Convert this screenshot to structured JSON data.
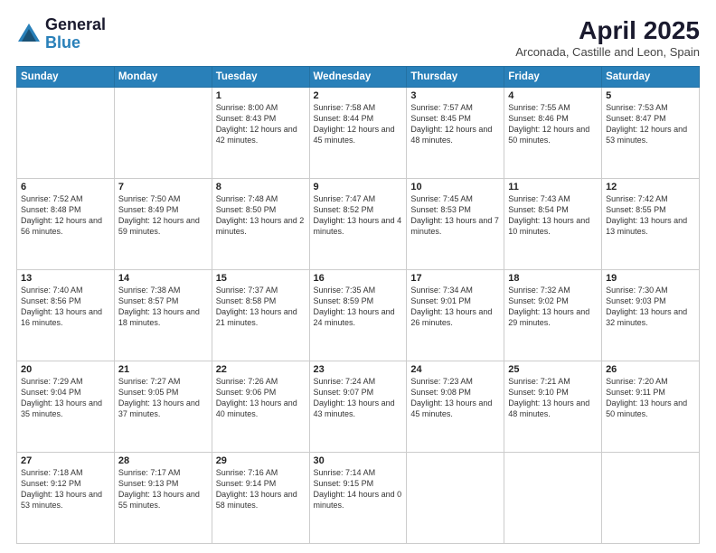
{
  "header": {
    "logo_general": "General",
    "logo_blue": "Blue",
    "month_year": "April 2025",
    "location": "Arconada, Castille and Leon, Spain"
  },
  "days_of_week": [
    "Sunday",
    "Monday",
    "Tuesday",
    "Wednesday",
    "Thursday",
    "Friday",
    "Saturday"
  ],
  "weeks": [
    [
      {
        "day": "",
        "sunrise": "",
        "sunset": "",
        "daylight": ""
      },
      {
        "day": "",
        "sunrise": "",
        "sunset": "",
        "daylight": ""
      },
      {
        "day": "1",
        "sunrise": "Sunrise: 8:00 AM",
        "sunset": "Sunset: 8:43 PM",
        "daylight": "Daylight: 12 hours and 42 minutes."
      },
      {
        "day": "2",
        "sunrise": "Sunrise: 7:58 AM",
        "sunset": "Sunset: 8:44 PM",
        "daylight": "Daylight: 12 hours and 45 minutes."
      },
      {
        "day": "3",
        "sunrise": "Sunrise: 7:57 AM",
        "sunset": "Sunset: 8:45 PM",
        "daylight": "Daylight: 12 hours and 48 minutes."
      },
      {
        "day": "4",
        "sunrise": "Sunrise: 7:55 AM",
        "sunset": "Sunset: 8:46 PM",
        "daylight": "Daylight: 12 hours and 50 minutes."
      },
      {
        "day": "5",
        "sunrise": "Sunrise: 7:53 AM",
        "sunset": "Sunset: 8:47 PM",
        "daylight": "Daylight: 12 hours and 53 minutes."
      }
    ],
    [
      {
        "day": "6",
        "sunrise": "Sunrise: 7:52 AM",
        "sunset": "Sunset: 8:48 PM",
        "daylight": "Daylight: 12 hours and 56 minutes."
      },
      {
        "day": "7",
        "sunrise": "Sunrise: 7:50 AM",
        "sunset": "Sunset: 8:49 PM",
        "daylight": "Daylight: 12 hours and 59 minutes."
      },
      {
        "day": "8",
        "sunrise": "Sunrise: 7:48 AM",
        "sunset": "Sunset: 8:50 PM",
        "daylight": "Daylight: 13 hours and 2 minutes."
      },
      {
        "day": "9",
        "sunrise": "Sunrise: 7:47 AM",
        "sunset": "Sunset: 8:52 PM",
        "daylight": "Daylight: 13 hours and 4 minutes."
      },
      {
        "day": "10",
        "sunrise": "Sunrise: 7:45 AM",
        "sunset": "Sunset: 8:53 PM",
        "daylight": "Daylight: 13 hours and 7 minutes."
      },
      {
        "day": "11",
        "sunrise": "Sunrise: 7:43 AM",
        "sunset": "Sunset: 8:54 PM",
        "daylight": "Daylight: 13 hours and 10 minutes."
      },
      {
        "day": "12",
        "sunrise": "Sunrise: 7:42 AM",
        "sunset": "Sunset: 8:55 PM",
        "daylight": "Daylight: 13 hours and 13 minutes."
      }
    ],
    [
      {
        "day": "13",
        "sunrise": "Sunrise: 7:40 AM",
        "sunset": "Sunset: 8:56 PM",
        "daylight": "Daylight: 13 hours and 16 minutes."
      },
      {
        "day": "14",
        "sunrise": "Sunrise: 7:38 AM",
        "sunset": "Sunset: 8:57 PM",
        "daylight": "Daylight: 13 hours and 18 minutes."
      },
      {
        "day": "15",
        "sunrise": "Sunrise: 7:37 AM",
        "sunset": "Sunset: 8:58 PM",
        "daylight": "Daylight: 13 hours and 21 minutes."
      },
      {
        "day": "16",
        "sunrise": "Sunrise: 7:35 AM",
        "sunset": "Sunset: 8:59 PM",
        "daylight": "Daylight: 13 hours and 24 minutes."
      },
      {
        "day": "17",
        "sunrise": "Sunrise: 7:34 AM",
        "sunset": "Sunset: 9:01 PM",
        "daylight": "Daylight: 13 hours and 26 minutes."
      },
      {
        "day": "18",
        "sunrise": "Sunrise: 7:32 AM",
        "sunset": "Sunset: 9:02 PM",
        "daylight": "Daylight: 13 hours and 29 minutes."
      },
      {
        "day": "19",
        "sunrise": "Sunrise: 7:30 AM",
        "sunset": "Sunset: 9:03 PM",
        "daylight": "Daylight: 13 hours and 32 minutes."
      }
    ],
    [
      {
        "day": "20",
        "sunrise": "Sunrise: 7:29 AM",
        "sunset": "Sunset: 9:04 PM",
        "daylight": "Daylight: 13 hours and 35 minutes."
      },
      {
        "day": "21",
        "sunrise": "Sunrise: 7:27 AM",
        "sunset": "Sunset: 9:05 PM",
        "daylight": "Daylight: 13 hours and 37 minutes."
      },
      {
        "day": "22",
        "sunrise": "Sunrise: 7:26 AM",
        "sunset": "Sunset: 9:06 PM",
        "daylight": "Daylight: 13 hours and 40 minutes."
      },
      {
        "day": "23",
        "sunrise": "Sunrise: 7:24 AM",
        "sunset": "Sunset: 9:07 PM",
        "daylight": "Daylight: 13 hours and 43 minutes."
      },
      {
        "day": "24",
        "sunrise": "Sunrise: 7:23 AM",
        "sunset": "Sunset: 9:08 PM",
        "daylight": "Daylight: 13 hours and 45 minutes."
      },
      {
        "day": "25",
        "sunrise": "Sunrise: 7:21 AM",
        "sunset": "Sunset: 9:10 PM",
        "daylight": "Daylight: 13 hours and 48 minutes."
      },
      {
        "day": "26",
        "sunrise": "Sunrise: 7:20 AM",
        "sunset": "Sunset: 9:11 PM",
        "daylight": "Daylight: 13 hours and 50 minutes."
      }
    ],
    [
      {
        "day": "27",
        "sunrise": "Sunrise: 7:18 AM",
        "sunset": "Sunset: 9:12 PM",
        "daylight": "Daylight: 13 hours and 53 minutes."
      },
      {
        "day": "28",
        "sunrise": "Sunrise: 7:17 AM",
        "sunset": "Sunset: 9:13 PM",
        "daylight": "Daylight: 13 hours and 55 minutes."
      },
      {
        "day": "29",
        "sunrise": "Sunrise: 7:16 AM",
        "sunset": "Sunset: 9:14 PM",
        "daylight": "Daylight: 13 hours and 58 minutes."
      },
      {
        "day": "30",
        "sunrise": "Sunrise: 7:14 AM",
        "sunset": "Sunset: 9:15 PM",
        "daylight": "Daylight: 14 hours and 0 minutes."
      },
      {
        "day": "",
        "sunrise": "",
        "sunset": "",
        "daylight": ""
      },
      {
        "day": "",
        "sunrise": "",
        "sunset": "",
        "daylight": ""
      },
      {
        "day": "",
        "sunrise": "",
        "sunset": "",
        "daylight": ""
      }
    ]
  ]
}
